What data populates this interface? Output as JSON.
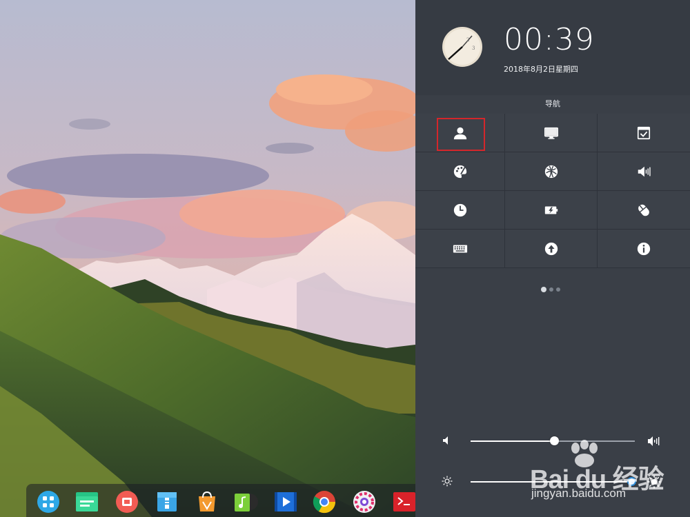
{
  "clock": {
    "time": "00:39",
    "date": "2018年8月2日星期四"
  },
  "navigation": {
    "title": "导航",
    "items": [
      {
        "icon": "user-account-icon",
        "selected": true
      },
      {
        "icon": "display-monitor-icon",
        "selected": false
      },
      {
        "icon": "default-apps-icon",
        "selected": false
      },
      {
        "icon": "personalization-palette-icon",
        "selected": false
      },
      {
        "icon": "network-globe-icon",
        "selected": false
      },
      {
        "icon": "sound-speaker-icon",
        "selected": false
      },
      {
        "icon": "time-clock-icon",
        "selected": false
      },
      {
        "icon": "power-battery-icon",
        "selected": false
      },
      {
        "icon": "mouse-icon",
        "selected": false
      },
      {
        "icon": "keyboard-icon",
        "selected": false
      },
      {
        "icon": "update-arrow-icon",
        "selected": false
      },
      {
        "icon": "system-info-icon",
        "selected": false
      }
    ],
    "page_count": 3,
    "current_page": 1
  },
  "sliders": {
    "volume_percent": 51,
    "brightness_percent": 98
  },
  "dock": {
    "apps": [
      "launcher-icon",
      "file-manager-icon",
      "screen-recorder-icon",
      "archive-manager-icon",
      "app-store-icon",
      "music-player-icon",
      "video-player-icon",
      "chrome-browser-icon",
      "system-settings-icon",
      "terminal-icon"
    ]
  },
  "watermark": {
    "logo_text": "Bai du 经验",
    "url": "jingyan.baidu.com"
  },
  "colors": {
    "panel_bg": "#3a3f47",
    "clock_bg": "#363b43",
    "selection_border": "#d5262b",
    "accent_blue": "#2e8bd6"
  }
}
